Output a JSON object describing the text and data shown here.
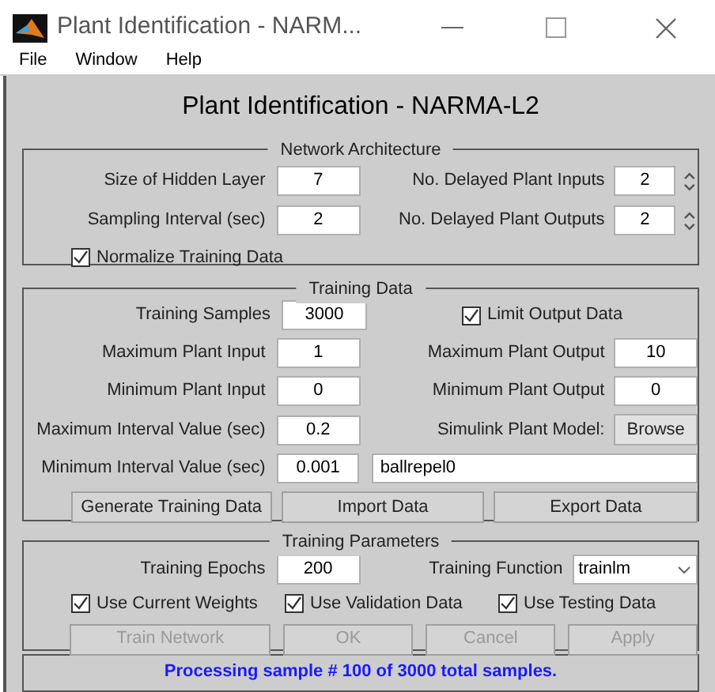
{
  "window": {
    "title": "Plant Identification - NARM..."
  },
  "menu": [
    "File",
    "Window",
    "Help"
  ],
  "heading": "Plant Identification - NARMA-L2",
  "network_architecture": {
    "title": "Network Architecture",
    "hidden_layer": {
      "label": "Size of Hidden Layer",
      "value": "7"
    },
    "sampling_interval": {
      "label": "Sampling Interval (sec)",
      "value": "2"
    },
    "delayed_inputs": {
      "label": "No. Delayed Plant Inputs",
      "value": "2"
    },
    "delayed_outputs": {
      "label": "No. Delayed Plant Outputs",
      "value": "2"
    },
    "normalize": {
      "label": "Normalize Training Data",
      "checked": true
    }
  },
  "training_data": {
    "title": "Training Data",
    "training_samples": {
      "label": "Training Samples",
      "value": "3000"
    },
    "limit_output": {
      "label": "Limit Output Data",
      "checked": true
    },
    "max_input": {
      "label": "Maximum Plant Input",
      "value": "1"
    },
    "max_output": {
      "label": "Maximum Plant Output",
      "value": "10"
    },
    "min_input": {
      "label": "Minimum Plant Input",
      "value": "0"
    },
    "min_output": {
      "label": "Minimum Plant Output",
      "value": "0"
    },
    "max_interval": {
      "label": "Maximum Interval Value (sec)",
      "value": "0.2"
    },
    "plant_model": {
      "label": "Simulink Plant Model:",
      "button": "Browse"
    },
    "min_interval": {
      "label": "Minimum Interval Value (sec)",
      "value": "0.001"
    },
    "model_name": {
      "value": "ballrepel0"
    },
    "buttons": [
      {
        "label": "Generate Training Data",
        "disabled": false
      },
      {
        "label": "Import Data",
        "disabled": false
      },
      {
        "label": "Export Data",
        "disabled": false
      }
    ]
  },
  "training_parameters": {
    "title": "Training Parameters",
    "epochs": {
      "label": "Training Epochs",
      "value": "200"
    },
    "function": {
      "label": "Training Function",
      "value": "trainlm"
    },
    "checkboxes": [
      {
        "label": "Use Current Weights",
        "checked": true
      },
      {
        "label": "Use Validation Data",
        "checked": true
      },
      {
        "label": "Use Testing Data",
        "checked": true
      }
    ],
    "buttons": [
      {
        "label": "Train Network",
        "disabled": true
      },
      {
        "label": "OK",
        "disabled": true
      },
      {
        "label": "Cancel",
        "disabled": true
      },
      {
        "label": "Apply",
        "disabled": true
      }
    ]
  },
  "status": "Processing sample # 100 of 3000 total samples."
}
